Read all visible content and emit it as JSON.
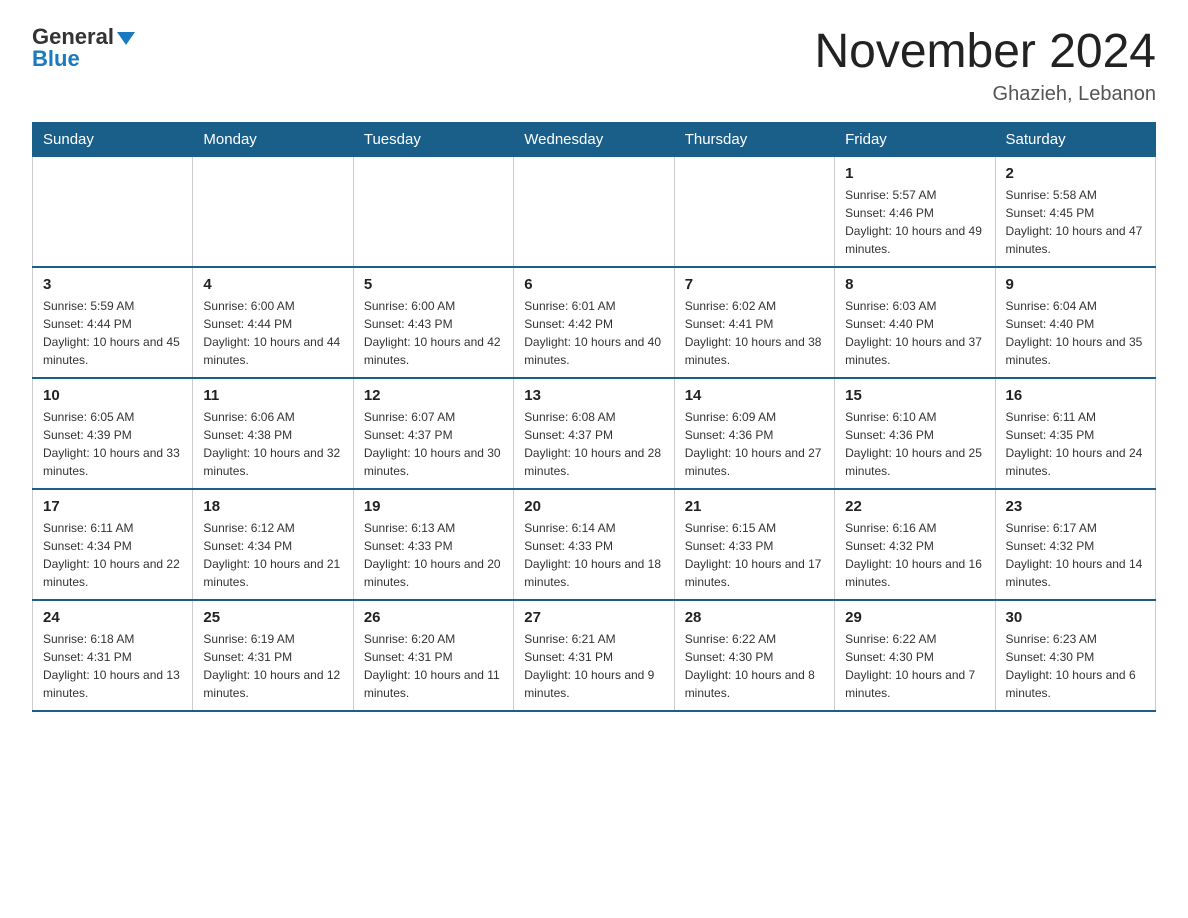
{
  "header": {
    "logo_general": "General",
    "logo_blue": "Blue",
    "month_title": "November 2024",
    "location": "Ghazieh, Lebanon"
  },
  "days_of_week": [
    "Sunday",
    "Monday",
    "Tuesday",
    "Wednesday",
    "Thursday",
    "Friday",
    "Saturday"
  ],
  "weeks": [
    [
      {
        "day": "",
        "info": ""
      },
      {
        "day": "",
        "info": ""
      },
      {
        "day": "",
        "info": ""
      },
      {
        "day": "",
        "info": ""
      },
      {
        "day": "",
        "info": ""
      },
      {
        "day": "1",
        "info": "Sunrise: 5:57 AM\nSunset: 4:46 PM\nDaylight: 10 hours and 49 minutes."
      },
      {
        "day": "2",
        "info": "Sunrise: 5:58 AM\nSunset: 4:45 PM\nDaylight: 10 hours and 47 minutes."
      }
    ],
    [
      {
        "day": "3",
        "info": "Sunrise: 5:59 AM\nSunset: 4:44 PM\nDaylight: 10 hours and 45 minutes."
      },
      {
        "day": "4",
        "info": "Sunrise: 6:00 AM\nSunset: 4:44 PM\nDaylight: 10 hours and 44 minutes."
      },
      {
        "day": "5",
        "info": "Sunrise: 6:00 AM\nSunset: 4:43 PM\nDaylight: 10 hours and 42 minutes."
      },
      {
        "day": "6",
        "info": "Sunrise: 6:01 AM\nSunset: 4:42 PM\nDaylight: 10 hours and 40 minutes."
      },
      {
        "day": "7",
        "info": "Sunrise: 6:02 AM\nSunset: 4:41 PM\nDaylight: 10 hours and 38 minutes."
      },
      {
        "day": "8",
        "info": "Sunrise: 6:03 AM\nSunset: 4:40 PM\nDaylight: 10 hours and 37 minutes."
      },
      {
        "day": "9",
        "info": "Sunrise: 6:04 AM\nSunset: 4:40 PM\nDaylight: 10 hours and 35 minutes."
      }
    ],
    [
      {
        "day": "10",
        "info": "Sunrise: 6:05 AM\nSunset: 4:39 PM\nDaylight: 10 hours and 33 minutes."
      },
      {
        "day": "11",
        "info": "Sunrise: 6:06 AM\nSunset: 4:38 PM\nDaylight: 10 hours and 32 minutes."
      },
      {
        "day": "12",
        "info": "Sunrise: 6:07 AM\nSunset: 4:37 PM\nDaylight: 10 hours and 30 minutes."
      },
      {
        "day": "13",
        "info": "Sunrise: 6:08 AM\nSunset: 4:37 PM\nDaylight: 10 hours and 28 minutes."
      },
      {
        "day": "14",
        "info": "Sunrise: 6:09 AM\nSunset: 4:36 PM\nDaylight: 10 hours and 27 minutes."
      },
      {
        "day": "15",
        "info": "Sunrise: 6:10 AM\nSunset: 4:36 PM\nDaylight: 10 hours and 25 minutes."
      },
      {
        "day": "16",
        "info": "Sunrise: 6:11 AM\nSunset: 4:35 PM\nDaylight: 10 hours and 24 minutes."
      }
    ],
    [
      {
        "day": "17",
        "info": "Sunrise: 6:11 AM\nSunset: 4:34 PM\nDaylight: 10 hours and 22 minutes."
      },
      {
        "day": "18",
        "info": "Sunrise: 6:12 AM\nSunset: 4:34 PM\nDaylight: 10 hours and 21 minutes."
      },
      {
        "day": "19",
        "info": "Sunrise: 6:13 AM\nSunset: 4:33 PM\nDaylight: 10 hours and 20 minutes."
      },
      {
        "day": "20",
        "info": "Sunrise: 6:14 AM\nSunset: 4:33 PM\nDaylight: 10 hours and 18 minutes."
      },
      {
        "day": "21",
        "info": "Sunrise: 6:15 AM\nSunset: 4:33 PM\nDaylight: 10 hours and 17 minutes."
      },
      {
        "day": "22",
        "info": "Sunrise: 6:16 AM\nSunset: 4:32 PM\nDaylight: 10 hours and 16 minutes."
      },
      {
        "day": "23",
        "info": "Sunrise: 6:17 AM\nSunset: 4:32 PM\nDaylight: 10 hours and 14 minutes."
      }
    ],
    [
      {
        "day": "24",
        "info": "Sunrise: 6:18 AM\nSunset: 4:31 PM\nDaylight: 10 hours and 13 minutes."
      },
      {
        "day": "25",
        "info": "Sunrise: 6:19 AM\nSunset: 4:31 PM\nDaylight: 10 hours and 12 minutes."
      },
      {
        "day": "26",
        "info": "Sunrise: 6:20 AM\nSunset: 4:31 PM\nDaylight: 10 hours and 11 minutes."
      },
      {
        "day": "27",
        "info": "Sunrise: 6:21 AM\nSunset: 4:31 PM\nDaylight: 10 hours and 9 minutes."
      },
      {
        "day": "28",
        "info": "Sunrise: 6:22 AM\nSunset: 4:30 PM\nDaylight: 10 hours and 8 minutes."
      },
      {
        "day": "29",
        "info": "Sunrise: 6:22 AM\nSunset: 4:30 PM\nDaylight: 10 hours and 7 minutes."
      },
      {
        "day": "30",
        "info": "Sunrise: 6:23 AM\nSunset: 4:30 PM\nDaylight: 10 hours and 6 minutes."
      }
    ]
  ]
}
